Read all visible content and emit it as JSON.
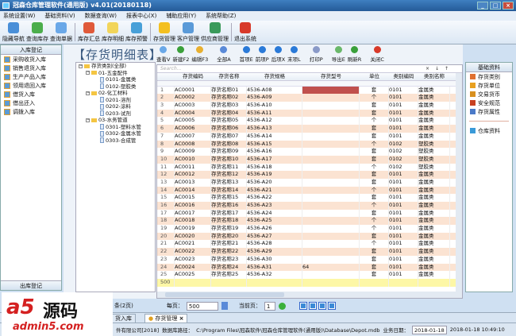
{
  "window": {
    "title": "冠森仓库管理软件(通用版) v4.01(20180118)"
  },
  "menu": [
    "系统设置(W)",
    "基础资料(V)",
    "数据查询(W)",
    "报表中心(X)",
    "辅助应用(Y)",
    "系统帮助(Z)"
  ],
  "toolbar": [
    {
      "label": "隐藏导航",
      "color": "#4a8fd8"
    },
    {
      "label": "查询库存",
      "color": "#4cae4c"
    },
    {
      "label": "查询单据",
      "color": "#6aa8e8"
    },
    {
      "label": "库存汇总",
      "color": "#e05a3a"
    },
    {
      "label": "库存明细",
      "color": "#f2d55a"
    },
    {
      "label": "库存预警",
      "color": "#48a0d8"
    },
    {
      "label": "存货管理",
      "color": "#f4c020"
    },
    {
      "label": "客户管理",
      "color": "#5a9ad8"
    },
    {
      "label": "供应商管理",
      "color": "#3a9a5a"
    },
    {
      "label": "退出系统",
      "color": "#d83a2a"
    }
  ],
  "left": {
    "title": "入库登记",
    "items": [
      "采购收货入库",
      "销售退货入库",
      "生产产品入库",
      "领用退回入库",
      "借货入库",
      "借出还入",
      "调拨入库"
    ],
    "bottom": "出库登记"
  },
  "page_title": "【存货明细表】",
  "tree": {
    "root": "存货类别(全部)",
    "groups": [
      {
        "label": "01-五金配件",
        "children": [
          "0101-金属类",
          "0102-塑胶类"
        ]
      },
      {
        "label": "02-化工材料",
        "children": [
          "0201-溶剂",
          "0202-涂料",
          "0203-试剂"
        ]
      },
      {
        "label": "03-水务管道",
        "children": [
          "0301-塑料水管",
          "0302-金属水管",
          "0303-合成管"
        ]
      }
    ]
  },
  "grid_toolbar": [
    {
      "label": "查看V",
      "color": "#6aa8e8"
    },
    {
      "label": "新建F2",
      "color": "#3aa03a"
    },
    {
      "label": "编辑F3",
      "color": "#e8b030"
    },
    {
      "label": "全部A",
      "color": "#5a8ad8"
    },
    {
      "label": "首项E",
      "color": "#2a7ad8"
    },
    {
      "label": "前项P",
      "color": "#2a7ad8"
    },
    {
      "label": "后项X",
      "color": "#2a7ad8"
    },
    {
      "label": "末项L",
      "color": "#2a7ad8"
    },
    {
      "label": "打印P",
      "color": "#8a9ac8"
    },
    {
      "label": "导出E",
      "color": "#6ab86a"
    },
    {
      "label": "刷新R",
      "color": "#3aa03a"
    },
    {
      "label": "关闭C",
      "color": "#d83a2a"
    }
  ],
  "search_placeholder": "Search...",
  "columns": [
    "存货编码",
    "存货名称",
    "存货规格",
    "存货型号",
    "单位",
    "类别编码",
    "类别名称"
  ],
  "rows": [
    [
      "1",
      "AC0001",
      "存货名称01",
      "4536-A08",
      "",
      "套",
      "0101",
      "金属类"
    ],
    [
      "2",
      "AC0002",
      "存货名称02",
      "4536-A09",
      "",
      "个",
      "0101",
      "金属类"
    ],
    [
      "3",
      "AC0003",
      "存货名称03",
      "4536-A10",
      "",
      "套",
      "0101",
      "金属类"
    ],
    [
      "4",
      "AC0004",
      "存货名称04",
      "4536-A11",
      "",
      "套",
      "0101",
      "金属类"
    ],
    [
      "5",
      "AC0005",
      "存货名称05",
      "4536-A12",
      "",
      "个",
      "0101",
      "金属类"
    ],
    [
      "6",
      "AC0006",
      "存货名称06",
      "4536-A13",
      "",
      "套",
      "0101",
      "金属类"
    ],
    [
      "7",
      "AC0007",
      "存货名称07",
      "4536-A14",
      "",
      "套",
      "0101",
      "金属类"
    ],
    [
      "8",
      "AC0008",
      "存货名称08",
      "4536-A15",
      "",
      "个",
      "0102",
      "塑胶类"
    ],
    [
      "9",
      "AC0009",
      "存货名称09",
      "4536-A16",
      "",
      "套",
      "0102",
      "塑胶类"
    ],
    [
      "10",
      "AC0010",
      "存货名称10",
      "4536-A17",
      "",
      "套",
      "0102",
      "塑胶类"
    ],
    [
      "11",
      "AC0011",
      "存货名称11",
      "4536-A18",
      "",
      "个",
      "0102",
      "塑胶类"
    ],
    [
      "12",
      "AC0012",
      "存货名称12",
      "4536-A19",
      "",
      "套",
      "0101",
      "金属类"
    ],
    [
      "13",
      "AC0013",
      "存货名称13",
      "4536-A20",
      "",
      "套",
      "0101",
      "金属类"
    ],
    [
      "14",
      "AC0014",
      "存货名称14",
      "4536-A21",
      "",
      "个",
      "0101",
      "金属类"
    ],
    [
      "15",
      "AC0015",
      "存货名称15",
      "4536-A22",
      "",
      "套",
      "0101",
      "金属类"
    ],
    [
      "16",
      "AC0016",
      "存货名称16",
      "4536-A23",
      "",
      "个",
      "0101",
      "金属类"
    ],
    [
      "17",
      "AC0017",
      "存货名称17",
      "4536-A24",
      "",
      "套",
      "0101",
      "金属类"
    ],
    [
      "18",
      "AC0018",
      "存货名称18",
      "4536-A25",
      "",
      "个",
      "0101",
      "金属类"
    ],
    [
      "19",
      "AC0019",
      "存货名称19",
      "4536-A26",
      "",
      "个",
      "0101",
      "金属类"
    ],
    [
      "20",
      "AC0020",
      "存货名称20",
      "4536-A27",
      "",
      "套",
      "0101",
      "金属类"
    ],
    [
      "21",
      "AC0021",
      "存货名称21",
      "4536-A28",
      "",
      "个",
      "0101",
      "金属类"
    ],
    [
      "22",
      "AC0022",
      "存货名称22",
      "4536-A29",
      "",
      "套",
      "0101",
      "金属类"
    ],
    [
      "23",
      "AC0023",
      "存货名称23",
      "4536-A30",
      "",
      "套",
      "0101",
      "金属类"
    ],
    [
      "24",
      "AC0024",
      "存货名称24",
      "4536-A31",
      "64",
      "套",
      "0101",
      "金属类"
    ],
    [
      "25",
      "AC0025",
      "存货名称25",
      "4536-A32",
      "",
      "套",
      "0101",
      "金属类"
    ]
  ],
  "new_row_label": "500",
  "selected_cell_color": "#c0504d",
  "right": {
    "title": "基础资料",
    "items": [
      {
        "label": "存货类别",
        "color": "#e07030"
      },
      {
        "label": "存货单位",
        "color": "#e8a020"
      },
      {
        "label": "交易货币",
        "color": "#d89020"
      },
      {
        "label": "安全规范",
        "color": "#c84020"
      },
      {
        "label": "存货属性",
        "color": "#4a7ac8"
      }
    ],
    "extra": {
      "label": "仓库资料",
      "color": "#3a9ad8"
    }
  },
  "pager": {
    "total": "条(2页)",
    "per_page_label": "每页：",
    "per_page": "500",
    "current_label": "当前页：",
    "current": "1"
  },
  "tabs": [
    "货入库",
    "存货管理"
  ],
  "status": {
    "company": "件有限公司[2018]",
    "db_label": "数据库路径：",
    "db_path": "C:\\Program Files\\冠森软件\\冠森仓库管理软件(通用版)\\Database\\Depot.mdb",
    "date_label": "业务日期：",
    "date": "2018-01-18",
    "datetime": "2018-01-18 10:49:10"
  },
  "watermark": {
    "brand": "a5源码",
    "url": "admin5.com"
  }
}
